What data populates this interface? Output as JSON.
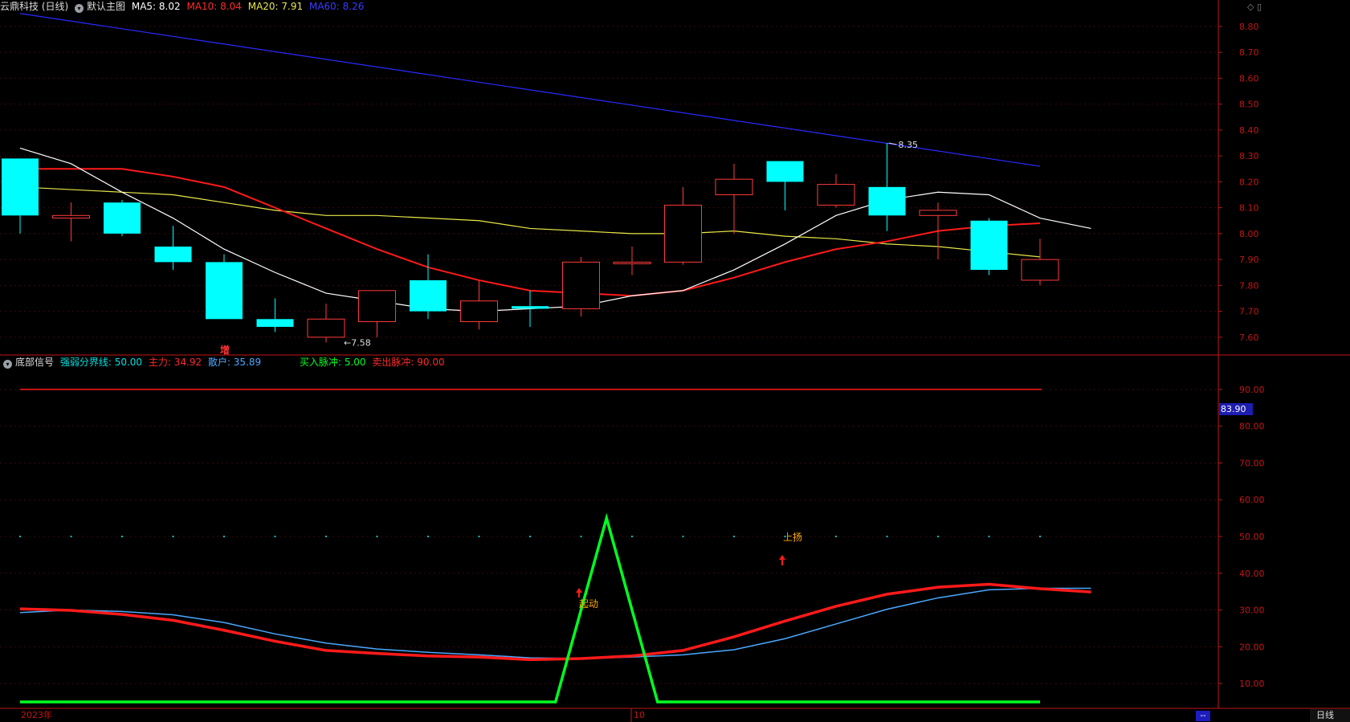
{
  "header_main": {
    "stock_name": "云鼎科技 (日线)",
    "chart_name": "默认主图",
    "ma5_label": "MA5: 8.02",
    "ma10_label": "MA10: 8.04",
    "ma20_label": "MA20: 7.91",
    "ma60_label": "MA60: 8.26"
  },
  "header_sub": {
    "indicator_name": "底部信号",
    "threshold_label": "强弱分界线: 50.00",
    "main_force_label": "主力: 34.92",
    "retail_label": "散户: 35.89",
    "buy_pulse_label": "买入脉冲: 5.00",
    "sell_pulse_label": "卖出脉冲: 90.00"
  },
  "colors": {
    "up": "#ff3a3a",
    "down": "#00ffff",
    "ma5": "#ffffff",
    "ma10": "#ff1a1a",
    "ma20": "#e8e84a",
    "ma60": "#2a2aff",
    "main_force": "#ff1a1a",
    "retail": "#4aa8ff",
    "pulse": "#00ff22",
    "threshold": "#00ffff",
    "axis": "#c41515",
    "annotation": "#ffaa00"
  },
  "date_labels": {
    "start": "2023年",
    "mid": "10"
  },
  "timeframe_label": "日线",
  "mini_button": "--",
  "current_value_tag": "83.90",
  "chart_data": [
    {
      "type": "candlestick",
      "ylim": [
        7.55,
        8.84
      ],
      "yticks": [
        "8.80",
        "8.70",
        "8.60",
        "8.50",
        "8.40",
        "8.30",
        "8.20",
        "8.10",
        "8.00",
        "7.90",
        "7.80",
        "7.70",
        "7.60"
      ],
      "candles": [
        {
          "o": 8.29,
          "h": 8.29,
          "l": 8.0,
          "c": 8.07
        },
        {
          "o": 8.06,
          "h": 8.12,
          "l": 7.97,
          "c": 8.07
        },
        {
          "o": 8.12,
          "h": 8.13,
          "l": 7.99,
          "c": 8.0
        },
        {
          "o": 7.95,
          "h": 8.03,
          "l": 7.86,
          "c": 7.89
        },
        {
          "o": 7.89,
          "h": 7.92,
          "l": 7.67,
          "c": 7.67
        },
        {
          "o": 7.67,
          "h": 7.75,
          "l": 7.62,
          "c": 7.64
        },
        {
          "o": 7.6,
          "h": 7.73,
          "l": 7.58,
          "c": 7.67
        },
        {
          "o": 7.66,
          "h": 7.78,
          "l": 7.6,
          "c": 7.78
        },
        {
          "o": 7.82,
          "h": 7.92,
          "l": 7.67,
          "c": 7.7
        },
        {
          "o": 7.66,
          "h": 7.82,
          "l": 7.63,
          "c": 7.74
        },
        {
          "o": 7.72,
          "h": 7.78,
          "l": 7.64,
          "c": 7.71
        },
        {
          "o": 7.71,
          "h": 7.91,
          "l": 7.68,
          "c": 7.89
        },
        {
          "o": 7.89,
          "h": 7.95,
          "l": 7.84,
          "c": 7.89
        },
        {
          "o": 7.89,
          "h": 8.18,
          "l": 7.88,
          "c": 8.11
        },
        {
          "o": 8.15,
          "h": 8.27,
          "l": 8.0,
          "c": 8.21
        },
        {
          "o": 8.28,
          "h": 8.28,
          "l": 8.09,
          "c": 8.2
        },
        {
          "o": 8.11,
          "h": 8.23,
          "l": 8.1,
          "c": 8.19
        },
        {
          "o": 8.18,
          "h": 8.35,
          "l": 8.01,
          "c": 8.07
        },
        {
          "o": 8.07,
          "h": 8.12,
          "l": 7.9,
          "c": 8.09
        },
        {
          "o": 8.05,
          "h": 8.06,
          "l": 7.84,
          "c": 7.86
        },
        {
          "o": 7.82,
          "h": 7.98,
          "l": 7.8,
          "c": 7.9
        }
      ],
      "ma5": [
        8.33,
        8.27,
        8.16,
        8.06,
        7.94,
        7.85,
        7.77,
        7.74,
        7.71,
        7.7,
        7.71,
        7.72,
        7.76,
        7.78,
        7.86,
        7.96,
        8.07,
        8.13,
        8.16,
        8.15,
        8.06,
        8.02
      ],
      "ma10": [
        8.25,
        8.25,
        8.25,
        8.22,
        8.18,
        8.1,
        8.02,
        7.94,
        7.87,
        7.82,
        7.78,
        7.77,
        7.76,
        7.78,
        7.83,
        7.89,
        7.94,
        7.97,
        8.01,
        8.03,
        8.04
      ],
      "ma20": [
        8.18,
        8.17,
        8.16,
        8.15,
        8.12,
        8.09,
        8.07,
        8.07,
        8.06,
        8.05,
        8.02,
        8.01,
        8.0,
        8.0,
        8.01,
        7.99,
        7.98,
        7.96,
        7.95,
        7.93,
        7.91
      ],
      "ma60": [
        8.85,
        8.26
      ],
      "annotations": [
        {
          "text": "8.35",
          "label": "high"
        },
        {
          "text": "←7.58",
          "label": "low"
        },
        {
          "text": "增",
          "label": "mark"
        }
      ]
    },
    {
      "type": "line",
      "ylim": [
        5,
        95
      ],
      "yticks": [
        "90.00",
        "80.00",
        "70.00",
        "60.00",
        "50.00",
        "40.00",
        "30.00",
        "20.00",
        "10.00"
      ],
      "series": [
        {
          "name": "主力",
          "values": [
            30.3,
            29.9,
            28.8,
            27.2,
            24.5,
            21.5,
            19.0,
            18.2,
            17.5,
            17.2,
            16.5,
            16.8,
            17.5,
            19.0,
            22.7,
            27.0,
            31.0,
            34.3,
            36.2,
            37.0,
            35.8,
            34.9
          ]
        },
        {
          "name": "散户",
          "values": [
            29.3,
            30.0,
            29.6,
            28.7,
            26.6,
            23.5,
            21.0,
            19.4,
            18.5,
            17.8,
            17.0,
            16.8,
            17.2,
            17.8,
            19.2,
            22.2,
            26.2,
            30.2,
            33.3,
            35.5,
            35.9,
            35.9
          ]
        },
        {
          "name": "买入脉冲",
          "values": [
            5,
            5,
            5,
            5,
            5,
            5,
            5,
            5,
            5,
            5,
            5,
            55,
            5,
            5,
            5,
            5,
            5,
            5,
            5,
            5,
            5,
            5
          ]
        },
        {
          "name": "卖出脉冲",
          "values": [
            90,
            90,
            90,
            90,
            90,
            90,
            90,
            90,
            90,
            90,
            90,
            90,
            90,
            90,
            90,
            90,
            90,
            90,
            90,
            90,
            90,
            90
          ]
        }
      ],
      "threshold": 50,
      "annotations": [
        {
          "text": "起动",
          "index": 11.0,
          "value": 19
        },
        {
          "text": "上扬",
          "index": 15.0,
          "value": 41
        }
      ]
    }
  ]
}
